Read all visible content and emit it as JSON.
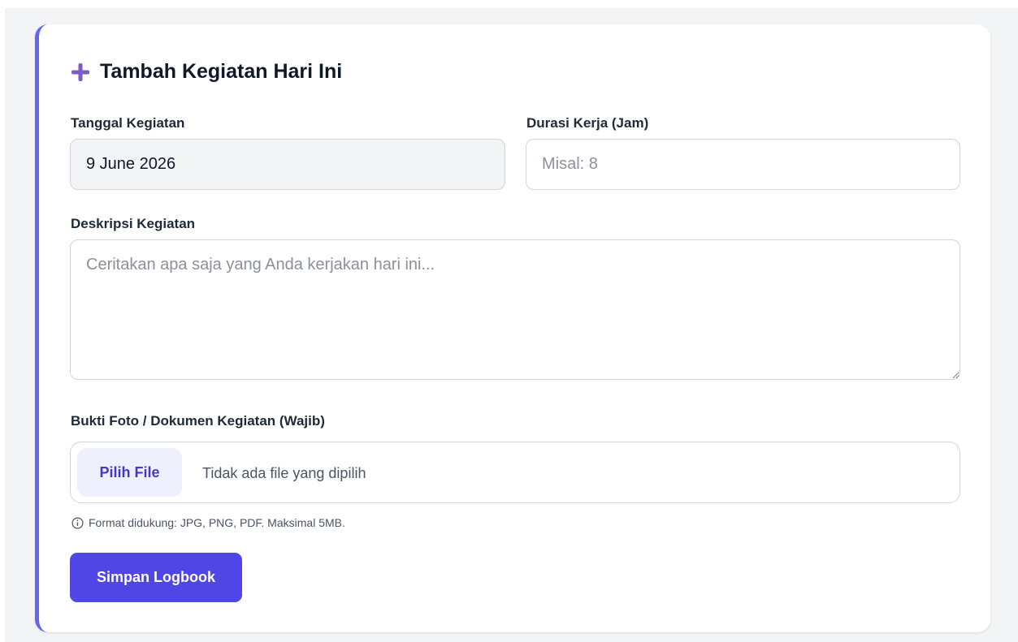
{
  "form": {
    "title": "Tambah Kegiatan Hari Ini",
    "title_icon": "plus-icon",
    "accent_color": "#6366f1",
    "date": {
      "label": "Tanggal Kegiatan",
      "value": "9 June 2026"
    },
    "duration": {
      "label": "Durasi Kerja (Jam)",
      "value": "",
      "placeholder": "Misal: 8"
    },
    "description": {
      "label": "Deskripsi Kegiatan",
      "value": "",
      "placeholder": "Ceritakan apa saja yang Anda kerjakan hari ini..."
    },
    "evidence": {
      "label": "Bukti Foto / Dokumen Kegiatan (Wajib)",
      "button_label": "Pilih File",
      "status": "Tidak ada file yang dipilih",
      "hint_icon": "info-icon",
      "hint": "Format didukung: JPG, PNG, PDF. Maksimal 5MB."
    },
    "submit_label": "Simpan Logbook",
    "submit_color": "#4f46e5"
  }
}
